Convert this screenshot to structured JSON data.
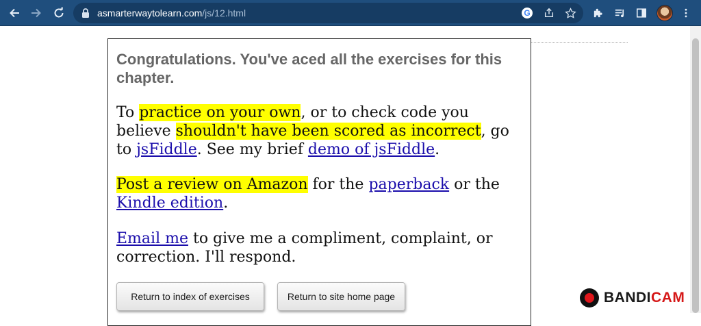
{
  "browser": {
    "url_domain": "asmarterwaytolearn.com",
    "url_path": "/js/12.html",
    "toolbar_color": "#1f4e7d",
    "icons": [
      "back-icon",
      "forward-icon",
      "reload-icon",
      "lock-icon",
      "google-icon",
      "share-icon",
      "star-icon",
      "extensions-icon",
      "media-icon",
      "side-panel-icon",
      "avatar",
      "menu-icon"
    ]
  },
  "page": {
    "heading": "Congratulations. You've aced all the exercises for this chapter.",
    "p1": {
      "text1": "To ",
      "hl1": "practice on your own",
      "text2": ", or to check code you believe ",
      "hl2": "shouldn't have been scored as incorrect",
      "text3": ", go to ",
      "link_jsfiddle": "jsFiddle",
      "text4": ". See my brief ",
      "link_demo": "demo of jsFiddle",
      "text5": "."
    },
    "p2": {
      "hl": "Post a review on Amazon",
      "text1": " for the ",
      "link_paperback": "paperback",
      "text2": " or the ",
      "link_kindle": "Kindle edition",
      "text3": "."
    },
    "p3": {
      "link_email": "Email me",
      "text1": " to give me a compliment, complaint, or correction. I'll respond."
    },
    "buttons": {
      "index": "Return to index of exercises",
      "home": "Return to site home page"
    },
    "highlight_color": "#ffff00",
    "link_color": "#1a0dab"
  },
  "watermark": {
    "part1": "BANDI",
    "part2": "CAM"
  }
}
